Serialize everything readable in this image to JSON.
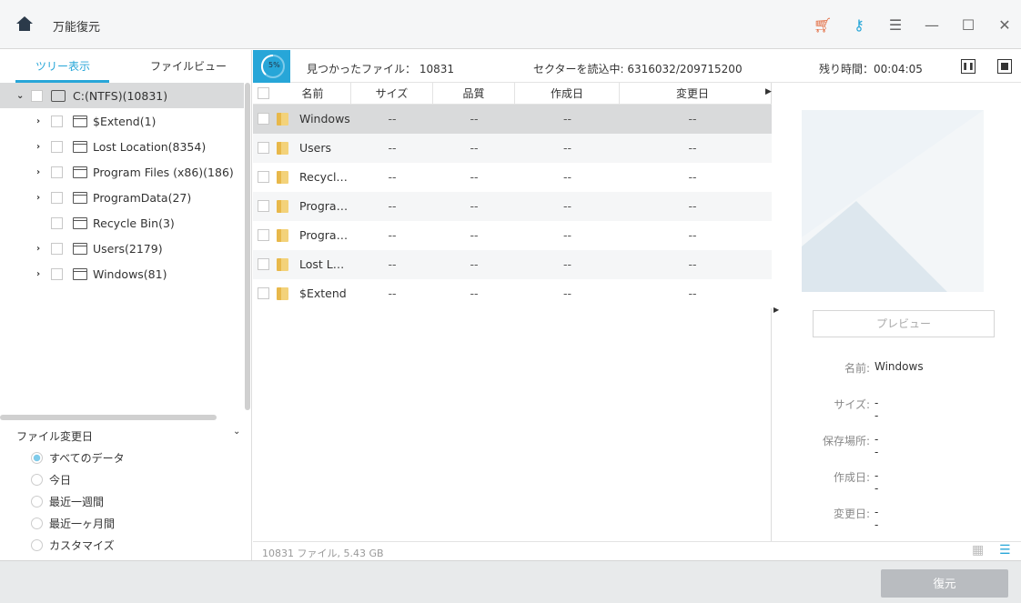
{
  "app": {
    "title": "万能復元"
  },
  "colors": {
    "accent": "#27a6d8",
    "cart": "#e2683c"
  },
  "left_tabs": [
    "ツリー表示",
    "ファイルビュー"
  ],
  "tree": [
    {
      "label": "C:(NTFS)(10831)",
      "level": 0,
      "expanded": true,
      "icon": "drive-icon"
    },
    {
      "label": "$Extend(1)",
      "level": 1,
      "expandable": true
    },
    {
      "label": "Lost Location(8354)",
      "level": 1,
      "expandable": true
    },
    {
      "label": "Program Files (x86)(186)",
      "level": 1,
      "expandable": true
    },
    {
      "label": "ProgramData(27)",
      "level": 1,
      "expandable": true
    },
    {
      "label": "Recycle Bin(3)",
      "level": 1,
      "expandable": false
    },
    {
      "label": "Users(2179)",
      "level": 1,
      "expandable": true
    },
    {
      "label": "Windows(81)",
      "level": 1,
      "expandable": true
    }
  ],
  "filter": {
    "title": "ファイル変更日",
    "options": [
      "すべてのデータ",
      "今日",
      "最近一週間",
      "最近一ヶ月間",
      "カスタマイズ"
    ],
    "selected": 0
  },
  "scan": {
    "progress_label": "5%",
    "progress": 5,
    "found": "見つかったファイル： 10831",
    "sectors": "セクターを読込中: 6316032/209715200",
    "remaining": "残り時間：00:04:05"
  },
  "columns": [
    "名前",
    "サイズ",
    "品質",
    "作成日",
    "変更日"
  ],
  "rows": [
    {
      "name": "Windows",
      "size": "--",
      "quality": "--",
      "created": "--",
      "modified": "--",
      "selected": true
    },
    {
      "name": "Users",
      "size": "--",
      "quality": "--",
      "created": "--",
      "modified": "--"
    },
    {
      "name": "Recycl…",
      "size": "--",
      "quality": "--",
      "created": "--",
      "modified": "--"
    },
    {
      "name": "Progra…",
      "size": "--",
      "quality": "--",
      "created": "--",
      "modified": "--"
    },
    {
      "name": "Progra…",
      "size": "--",
      "quality": "--",
      "created": "--",
      "modified": "--"
    },
    {
      "name": "Lost L…",
      "size": "--",
      "quality": "--",
      "created": "--",
      "modified": "--"
    },
    {
      "name": "$Extend",
      "size": "--",
      "quality": "--",
      "created": "--",
      "modified": "--"
    }
  ],
  "summary": "10831 ファイル, 5.43 GB",
  "preview": {
    "button": "プレビュー",
    "fields": [
      {
        "label": "名前:",
        "value": "Windows"
      },
      {
        "label": "サイズ:",
        "value": "--"
      },
      {
        "label": "保存場所:",
        "value": "--"
      },
      {
        "label": "作成日:",
        "value": "--"
      },
      {
        "label": "変更日:",
        "value": "--"
      }
    ]
  },
  "recover_button": "復元"
}
